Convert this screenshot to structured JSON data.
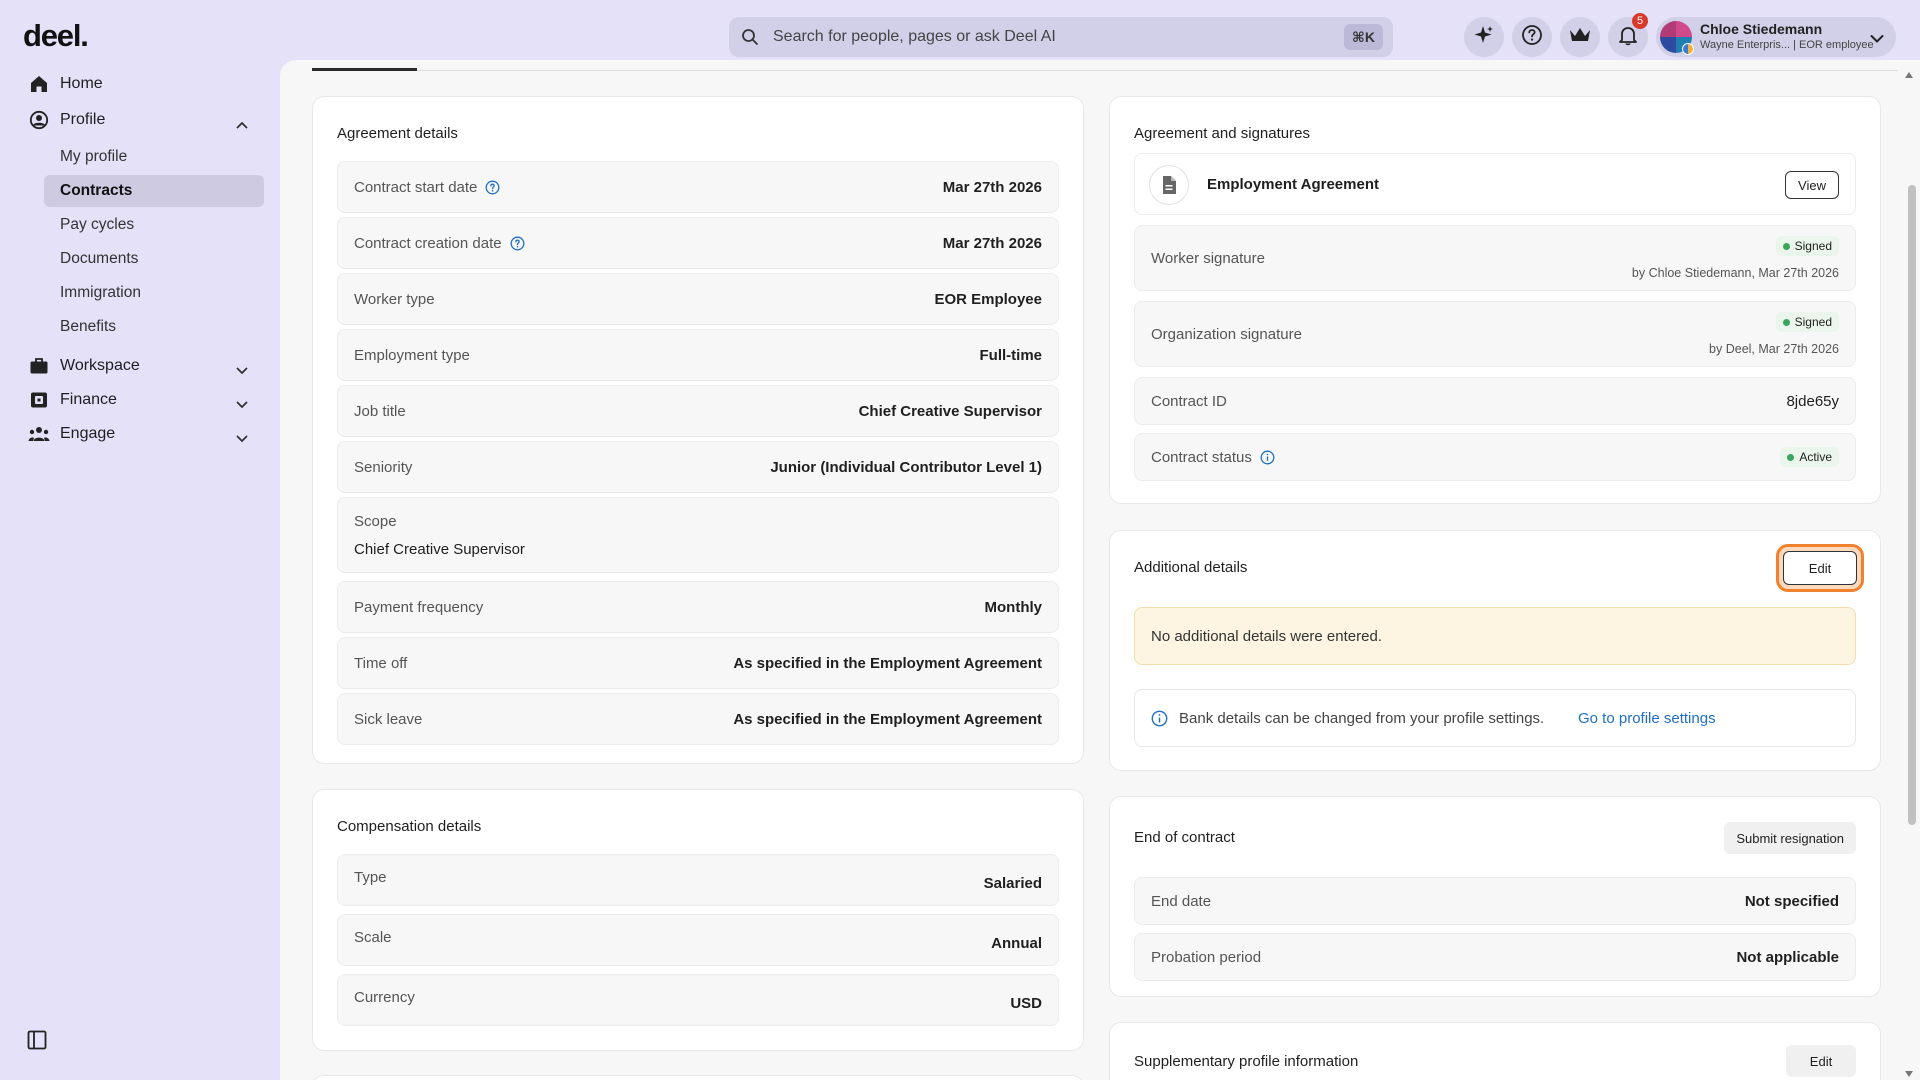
{
  "brand": {
    "logo": "deel."
  },
  "search": {
    "placeholder": "Search for people, pages or ask Deel AI",
    "shortcut": "⌘K"
  },
  "header": {
    "notifications_count": "5"
  },
  "user": {
    "name": "Chloe Stiedemann",
    "subtitle": "Wayne Enterpris... | EOR employee"
  },
  "sidebar": {
    "home": "Home",
    "profile": "Profile",
    "profile_items": [
      "My profile",
      "Contracts",
      "Pay cycles",
      "Documents",
      "Immigration",
      "Benefits"
    ],
    "active_item": "Contracts",
    "workspace": "Workspace",
    "finance": "Finance",
    "engage": "Engage"
  },
  "agreement_details": {
    "title": "Agreement details",
    "rows": [
      {
        "label": "Contract start date",
        "value": "Mar 27th 2026"
      },
      {
        "label": "Contract creation date",
        "value": "Mar 27th 2026"
      },
      {
        "label": "Worker type",
        "value": "EOR Employee"
      },
      {
        "label": "Employment type",
        "value": "Full-time"
      },
      {
        "label": "Job title",
        "value": "Chief Creative Supervisor"
      },
      {
        "label": "Seniority",
        "value": "Junior (Individual Contributor Level 1)"
      }
    ],
    "scope_label": "Scope",
    "scope_value": "Chief Creative Supervisor",
    "rows2": [
      {
        "label": "Payment frequency",
        "value": "Monthly"
      },
      {
        "label": "Time off",
        "value": "As specified in the Employment Agreement"
      },
      {
        "label": "Sick leave",
        "value": "As specified in the Employment Agreement"
      }
    ]
  },
  "compensation": {
    "title": "Compensation details",
    "rows": [
      {
        "label": "Type",
        "value": "Salaried"
      },
      {
        "label": "Scale",
        "value": "Annual"
      },
      {
        "label": "Currency",
        "value": "USD"
      }
    ]
  },
  "signatures": {
    "title": "Agreement and signatures",
    "document": "Employment Agreement",
    "view_label": "View",
    "worker_label": "Worker signature",
    "worker_status": "Signed",
    "worker_by": "by Chloe Stiedemann, Mar 27th 2026",
    "org_label": "Organization signature",
    "org_status": "Signed",
    "org_by": "by Deel, Mar 27th 2026",
    "contract_id_label": "Contract ID",
    "contract_id": "8jde65y",
    "status_label": "Contract status",
    "status": "Active"
  },
  "additional": {
    "title": "Additional details",
    "edit_label": "Edit",
    "empty_message": "No additional details were entered.",
    "bank_note": "Bank details can be changed from your profile settings.",
    "bank_link": "Go to profile settings"
  },
  "end_of_contract": {
    "title": "End of contract",
    "button": "Submit resignation",
    "end_date_label": "End date",
    "end_date": "Not specified",
    "probation_label": "Probation period",
    "probation": "Not applicable"
  },
  "supplementary": {
    "title": "Supplementary profile information",
    "edit_label": "Edit"
  },
  "colors": {
    "accent_ring": "#f0822e",
    "link": "#1f6fc5",
    "signed_dot": "#3aa55d",
    "header_bg": "#e4e1f8"
  }
}
